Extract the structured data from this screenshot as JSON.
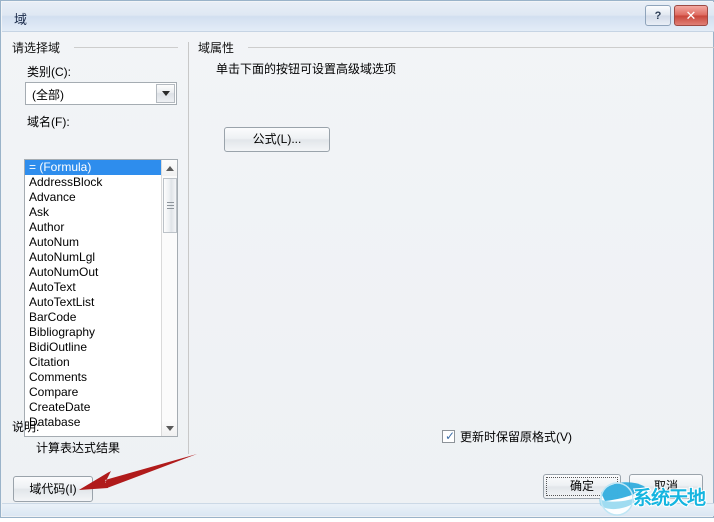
{
  "window": {
    "title": "域",
    "help_button": "?",
    "close_button": "✕"
  },
  "left_panel": {
    "group_title": "请选择域",
    "category_label": "类别(C):",
    "category_value": "(全部)",
    "field_name_label": "域名(F):",
    "field_names": [
      "= (Formula)",
      "AddressBlock",
      "Advance",
      "Ask",
      "Author",
      "AutoNum",
      "AutoNumLgl",
      "AutoNumOut",
      "AutoText",
      "AutoTextList",
      "BarCode",
      "Bibliography",
      "BidiOutline",
      "Citation",
      "Comments",
      "Compare",
      "CreateDate",
      "Database"
    ],
    "selected_index": 0,
    "description_label": "说明:",
    "description_text": "计算表达式结果",
    "field_code_button": "域代码(I)"
  },
  "right_panel": {
    "group_title": "域属性",
    "hint_text": "单击下面的按钮可设置高级域选项",
    "formula_button": "公式(L)...",
    "preserve_format_checkbox": {
      "label": "更新时保留原格式(V)",
      "checked": true,
      "mark": "✓"
    }
  },
  "footer": {
    "ok_button": "确定",
    "cancel_button": "取消"
  },
  "watermark": {
    "text": "系统天地"
  },
  "colors": {
    "selection_blue": "#2e8ded",
    "close_red": "#c9463a",
    "arrow_red": "#b01b1b",
    "watermark_cyan": "#15b5e0"
  }
}
